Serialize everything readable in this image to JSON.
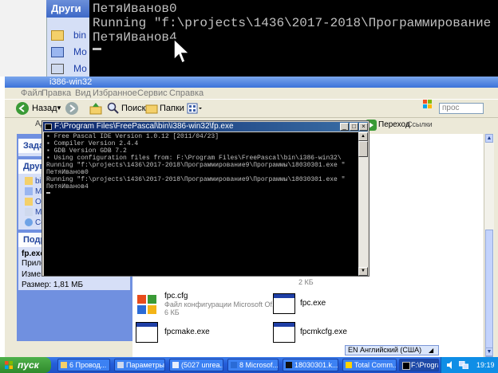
{
  "bg_console": {
    "lines": [
      "ПетяИванов0",
      "Running \"f:\\projects\\1436\\2017-2018\\Программирование",
      "ПетяИванов4"
    ]
  },
  "bg_explorer": {
    "pane_title": "Други",
    "items": [
      "bin",
      "Мо",
      "Мо"
    ]
  },
  "explorer": {
    "title": "i386-win32",
    "menu": [
      "Файл",
      "Правка",
      "Вид",
      "Избранное",
      "Сервис",
      "Справка"
    ],
    "toolbar": {
      "back": "Назад",
      "search": "Поиск",
      "folders": "Папки",
      "search_field_placeholder": "прос"
    },
    "address": {
      "label": "Адрес",
      "go": "Переход",
      "links": "Ссылки"
    },
    "side_tasks": {
      "tasks_head": "Задач",
      "other_head": "Други",
      "other_items": [
        "bin",
        "Мо",
        "Об",
        "Мо",
        "Се"
      ],
      "details_head": "Подро",
      "details_name": "fp.exe",
      "details_type": "Прилож",
      "details_changed": "Измене",
      "details_size": "Размер: 1,81 МБ"
    },
    "files": [
      {
        "name": "fpc.cfg",
        "sub1": "Файл конфигурации Microsoft Of...",
        "sub2": "6 КБ"
      },
      {
        "name": "fpc.exe",
        "sub1": "",
        "sub2": ""
      },
      {
        "name": "fpcmake.exe",
        "sub1": "",
        "sub2": ""
      },
      {
        "name": "fpcmkcfg.exe",
        "sub1": "",
        "sub2": ""
      }
    ],
    "upper_file_size": "2 КБ"
  },
  "fp_console": {
    "title": "F:\\Program Files\\FreePascal\\bin\\i386-win32\\fp.exe",
    "lines": [
      "▪ Free Pascal IDE Version 1.0.12 [2011/04/23]",
      "▪ Compiler Version 2.4.4",
      "▪ GDB Version GDB 7.2",
      "▪ Using configuration files from: F:\\Program Files\\FreePascal\\bin\\i386-win32\\",
      "Running \"f:\\projects\\1436\\2017-2018\\Программирование9\\Программы\\18030301.exe \"",
      "ПетяИванов0",
      "Running \"f:\\projects\\1436\\2017-2018\\Программирование9\\Программы\\18030301.exe \"",
      "ПетяИванов4"
    ]
  },
  "langbar": {
    "text": "EN Английский (США)"
  },
  "taskbar": {
    "start_label": "пуск",
    "tasks": [
      "6 Провод...",
      "Параметры...",
      "(5027 unrea...",
      "8 Microsof...",
      "18030301.k...",
      "Total Comm...",
      "F:\\Program ..."
    ],
    "clock": "19:19"
  },
  "colors": {
    "xp_blue": "#245edb",
    "start_green": "#2f8a2c",
    "console_bg": "#000000",
    "console_fg": "#c0c0c0"
  }
}
